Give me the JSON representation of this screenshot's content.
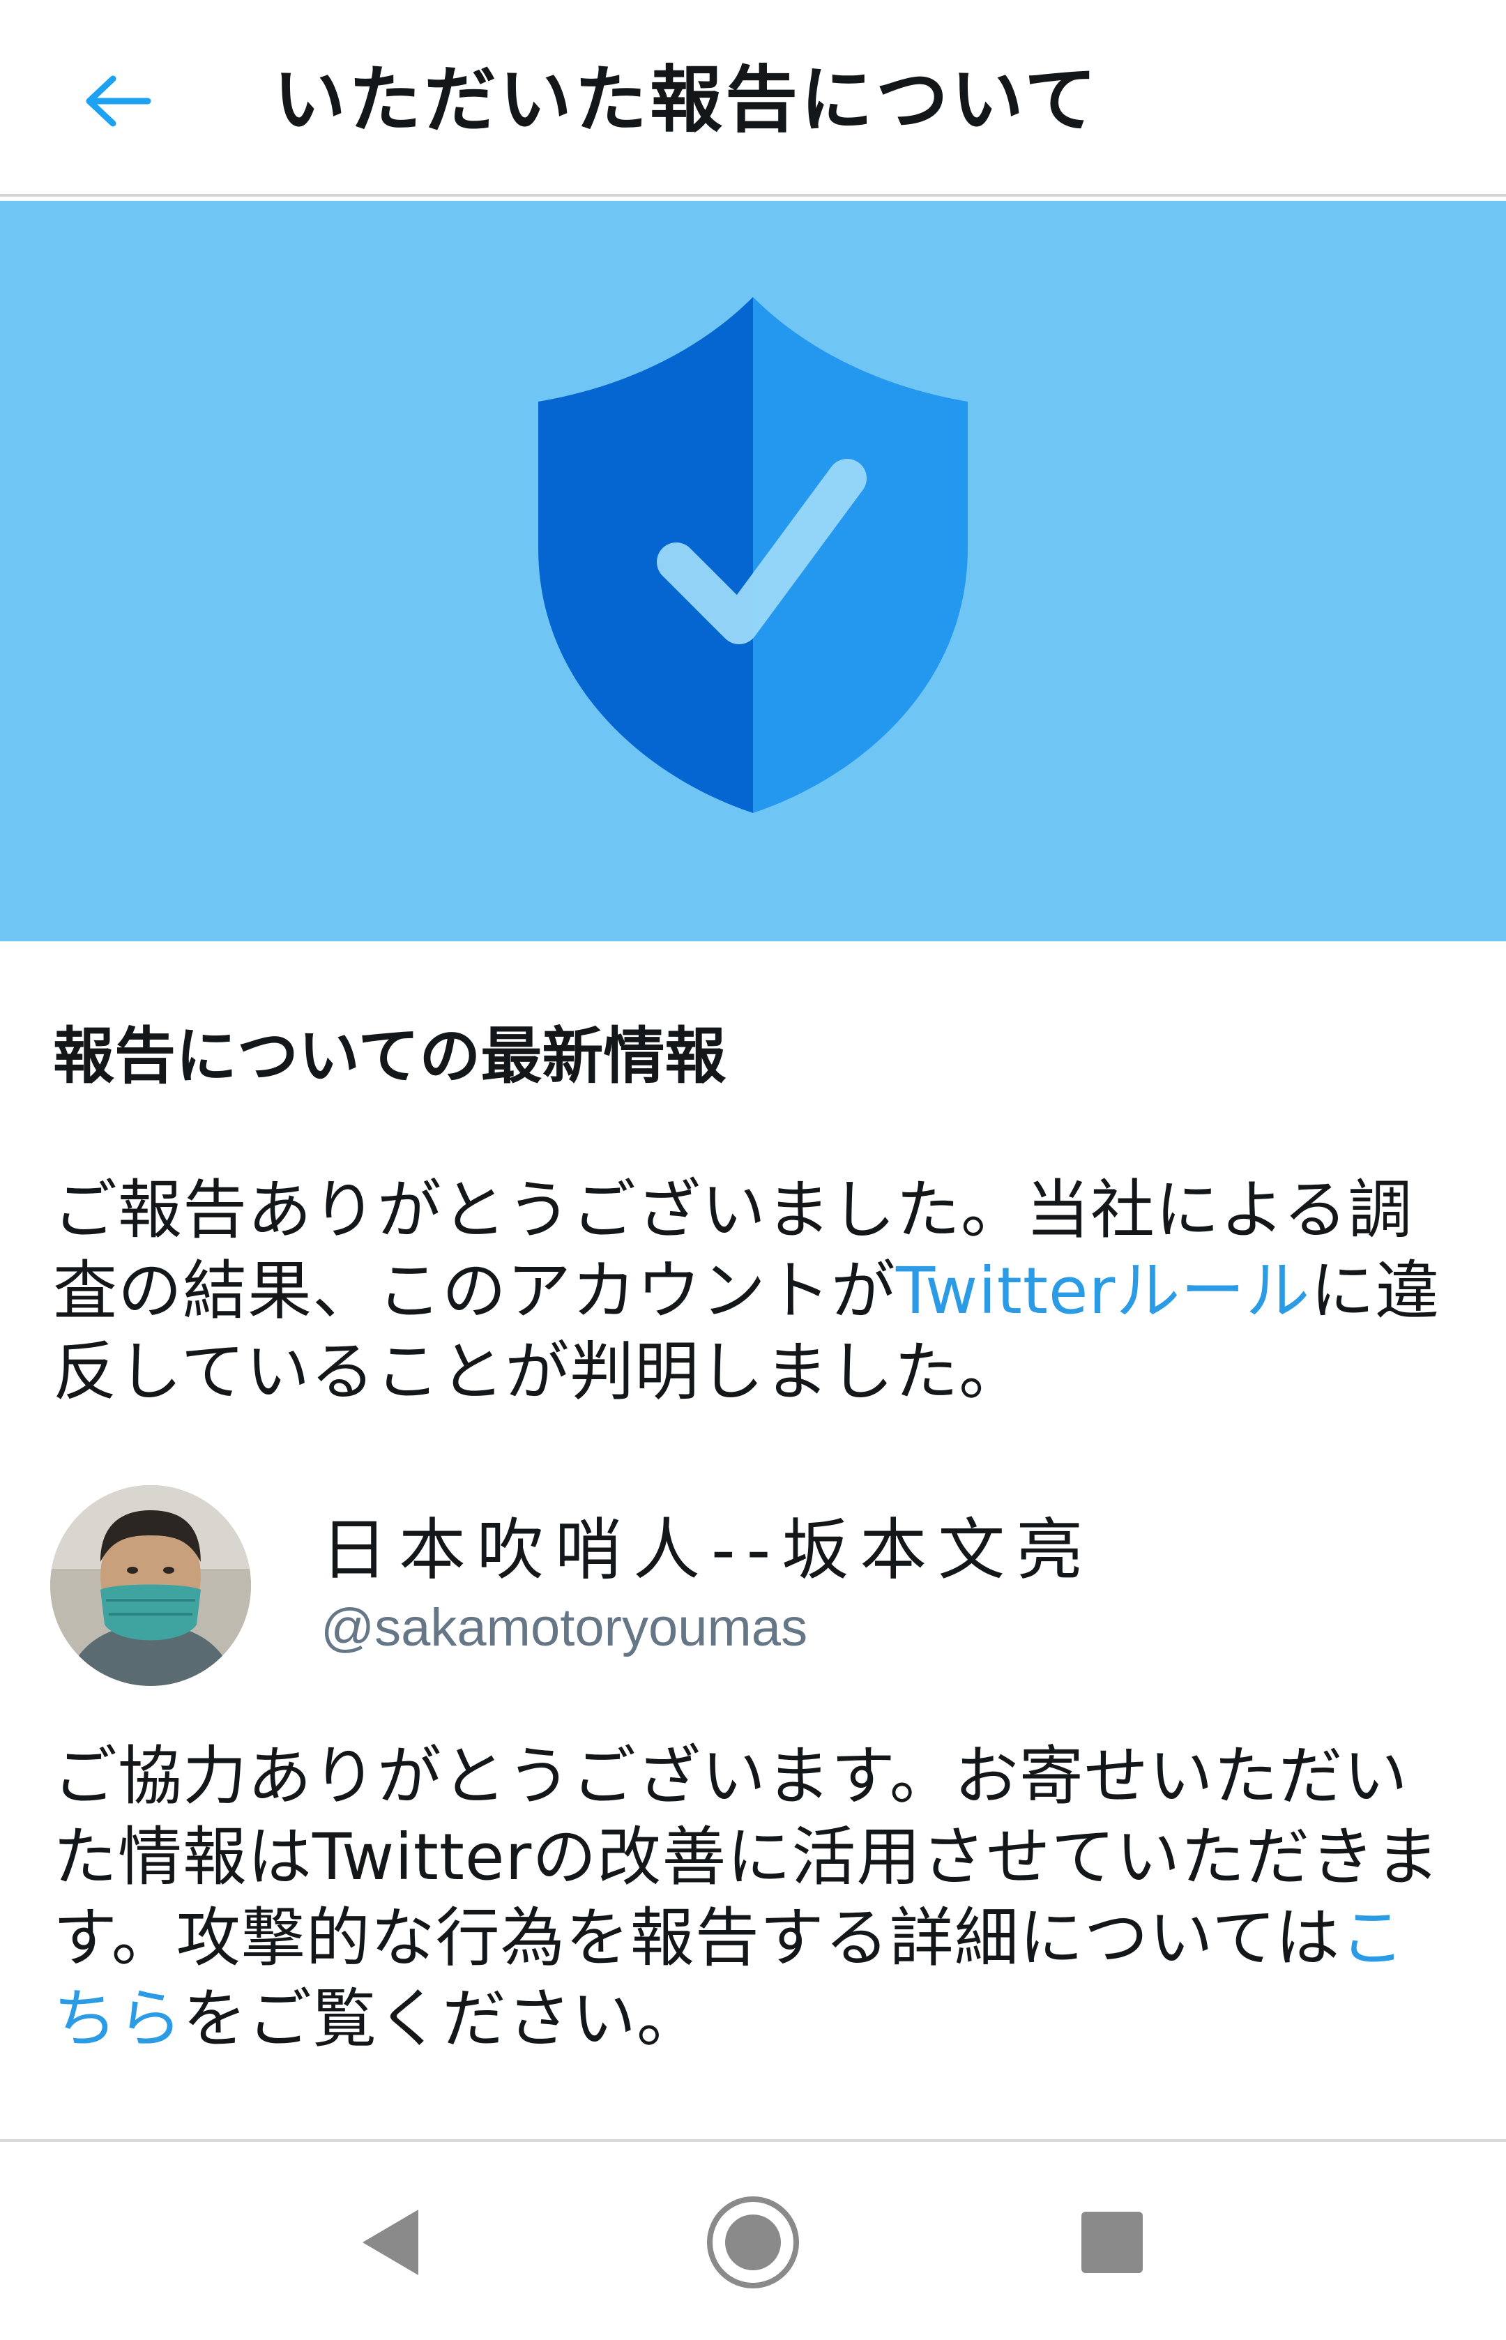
{
  "header": {
    "title": "いただいた報告について",
    "back_icon": "arrow-left-icon"
  },
  "hero": {
    "icon": "shield-check-icon",
    "background": "#6fc5f4"
  },
  "content": {
    "section_title": "報告についての最新情報",
    "paragraph1": {
      "text_before": "ご報告ありがとうございました。当社による調査の結果、このアカウントが",
      "link": "Twitterルール",
      "text_after": "に違反していることが判明しました。"
    },
    "account": {
      "display_name": "日本吹哨人--坂本文亮",
      "handle": "@sakamotoryoumas",
      "avatar_icon": "avatar"
    },
    "paragraph2": {
      "text_before": "ご協力ありがとうございます。お寄せいただいた情報はTwitterの改善に活用させていただきます。攻撃的な行為を報告する詳細については",
      "link": "こちら",
      "text_after": "をご覧ください。"
    }
  },
  "navbar": {
    "back_icon": "nav-back-triangle-icon",
    "home_icon": "nav-home-circle-icon",
    "recent_icon": "nav-recents-square-icon"
  },
  "colors": {
    "accent": "#1da1f2",
    "link": "#2c9be6",
    "hero_bg": "#6fc5f4",
    "shield_dark": "#0566d2",
    "shield_light": "#2398ee"
  }
}
